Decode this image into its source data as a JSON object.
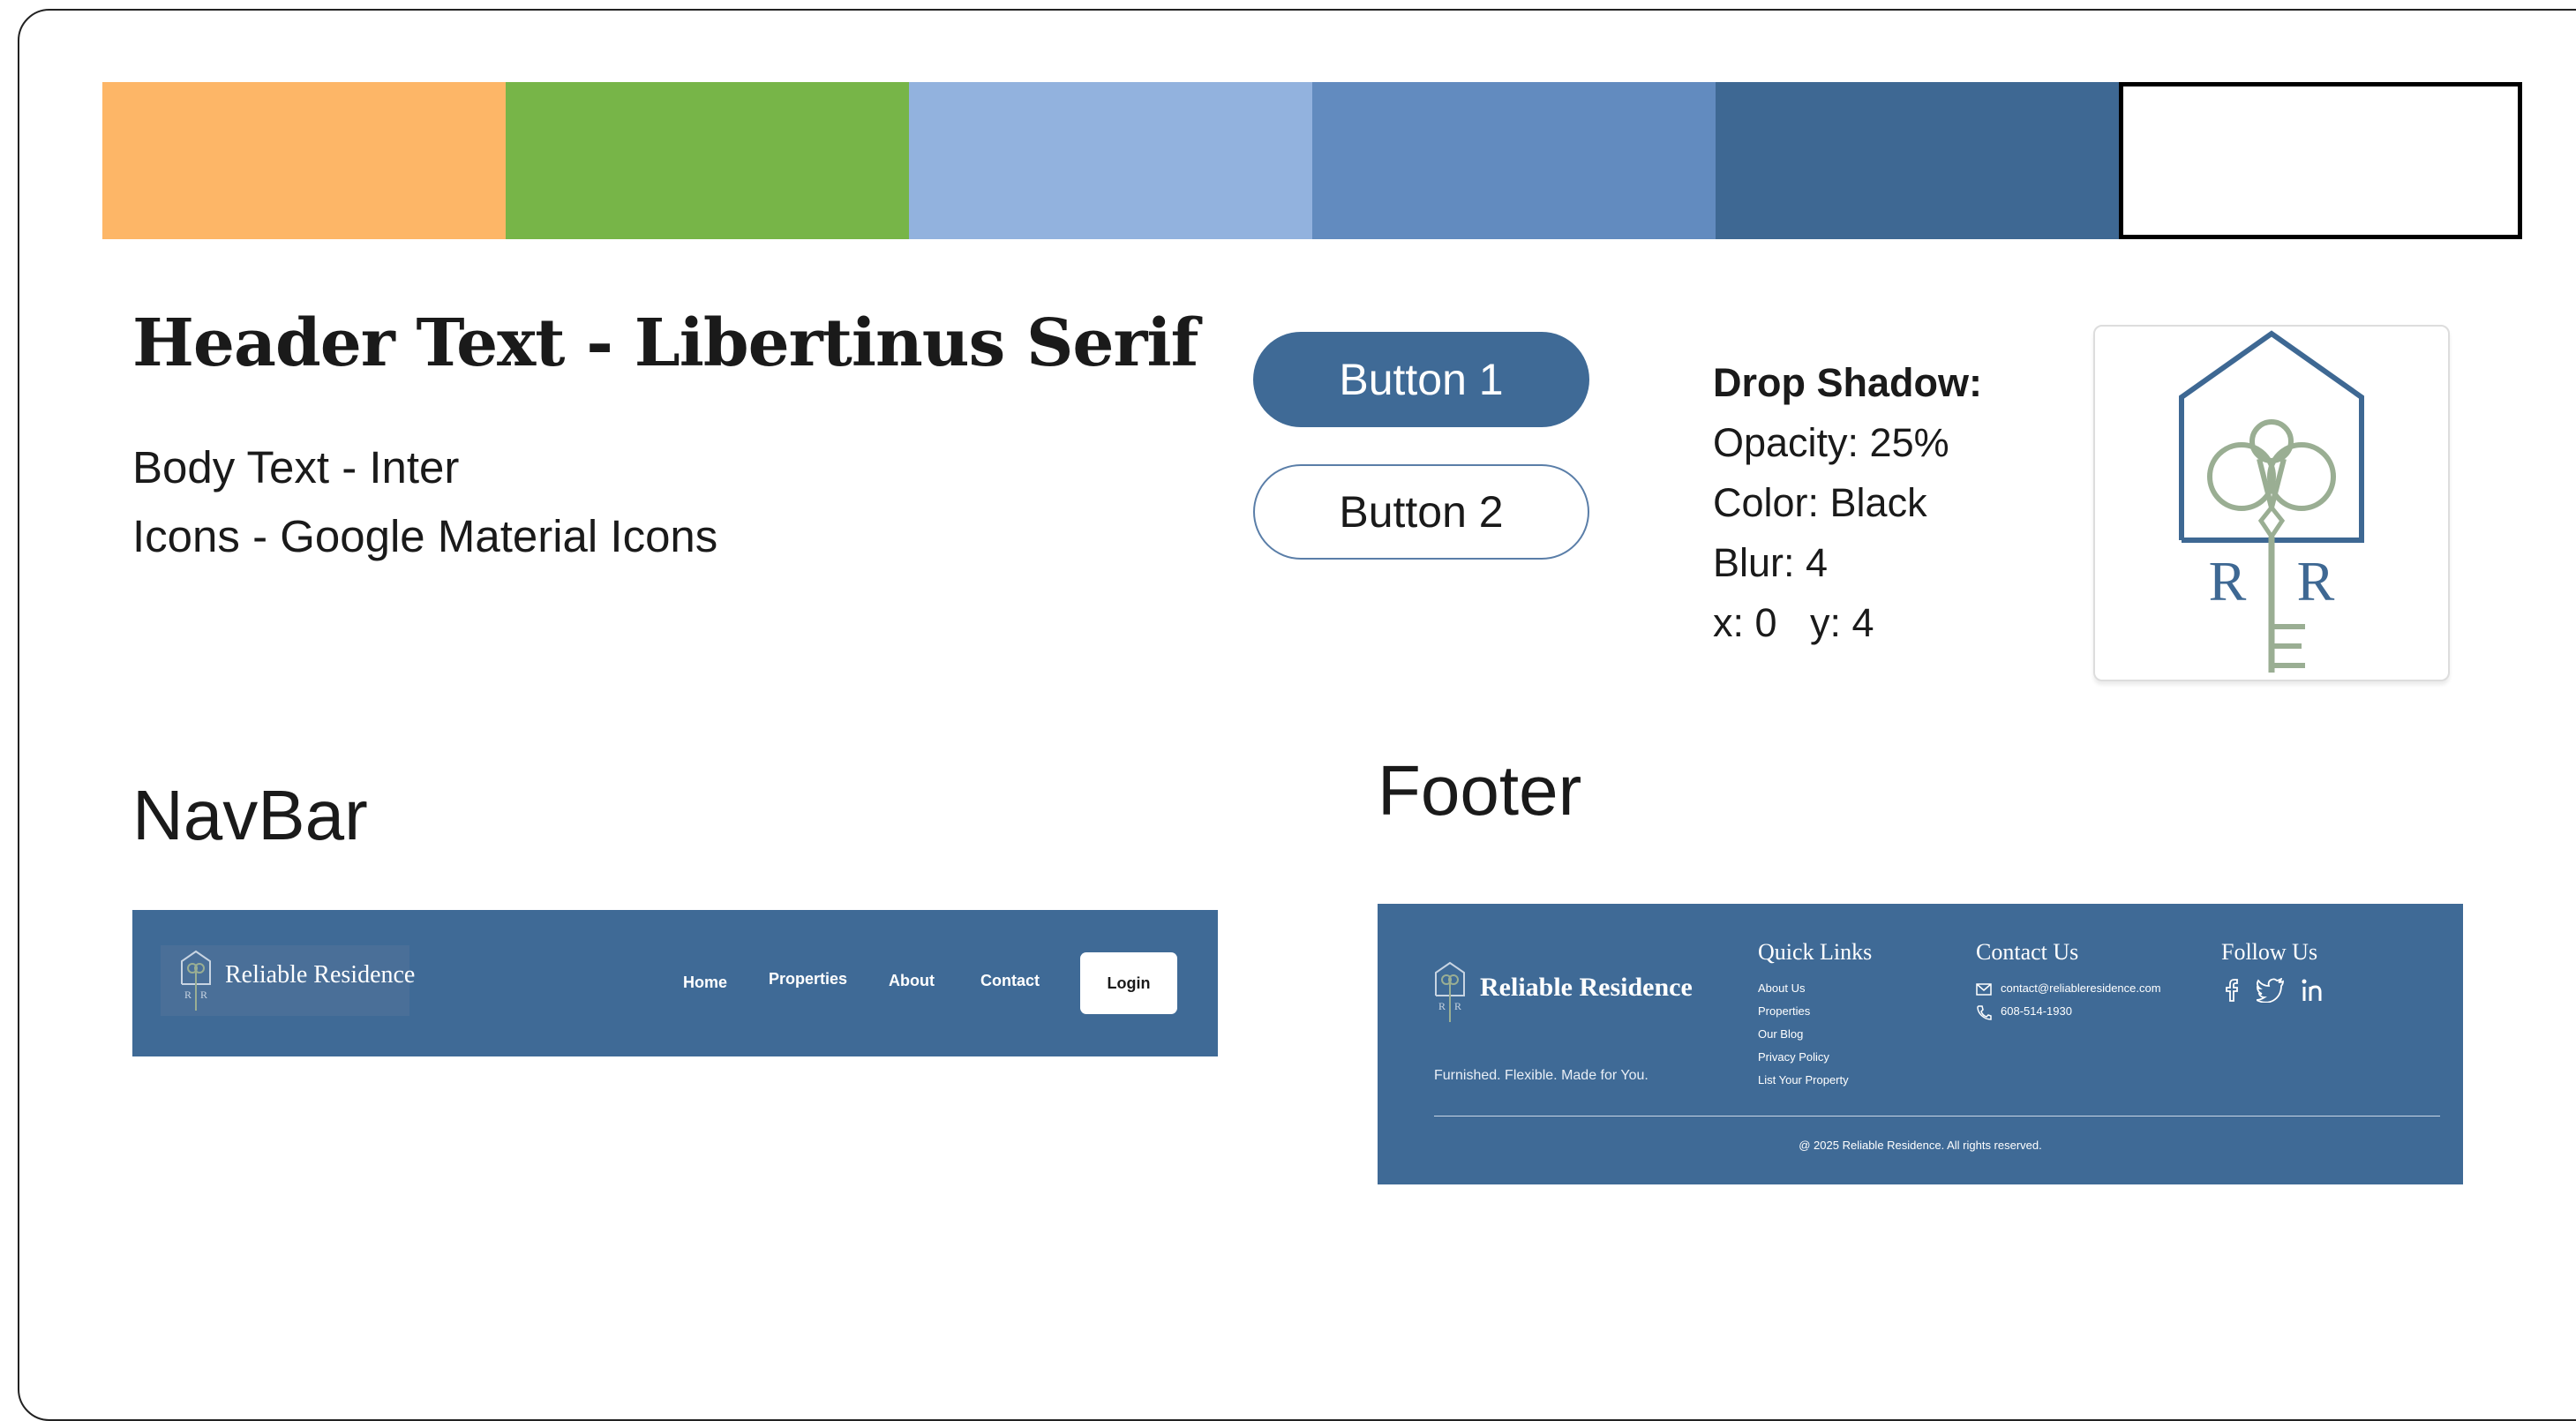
{
  "palette": {
    "swatches": [
      "#fdb667",
      "#77b548",
      "#92b2de",
      "#628bbf",
      "#3e6893",
      "#ffffff"
    ]
  },
  "typography": {
    "header_text": "Header Text - Libertinus Serif",
    "body_text": "Body Text - Inter",
    "icons_text": "Icons - Google Material Icons"
  },
  "buttons": {
    "button1_label": "Button 1",
    "button2_label": "Button 2"
  },
  "drop_shadow": {
    "title": "Drop Shadow:",
    "opacity": "Opacity: 25%",
    "color": "Color: Black",
    "blur": "Blur: 4",
    "offset": "x: 0   y: 4"
  },
  "logo": {
    "letters": "R R",
    "icon": "house-key-logo-icon"
  },
  "navbar_section": {
    "title": "NavBar",
    "brand": "Reliable Residence",
    "links": [
      "Home",
      "Properties",
      "About",
      "Contact"
    ],
    "login_label": "Login"
  },
  "footer_section": {
    "title": "Footer",
    "brand": "Reliable Residence",
    "tagline": "Furnished. Flexible. Made for You.",
    "quick_links_title": "Quick Links",
    "quick_links": [
      "About Us",
      "Properties",
      "Our Blog",
      "Privacy Policy",
      "List Your Property"
    ],
    "contact_title": "Contact Us",
    "email": "contact@reliableresidence.com",
    "phone": "608-514-1930",
    "follow_title": "Follow Us",
    "social_icons": [
      "facebook-icon",
      "twitter-icon",
      "linkedin-icon"
    ],
    "copyright": "@ 2025 Reliable Residence. All rights reserved."
  },
  "colors": {
    "primary_blue": "#3f6a96",
    "sage": "#9aae93"
  }
}
